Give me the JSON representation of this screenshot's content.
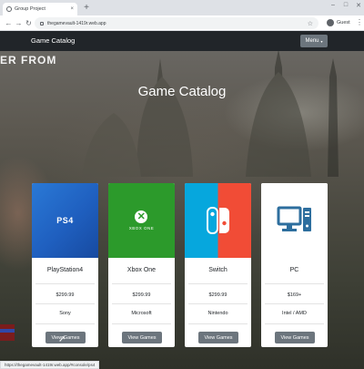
{
  "browser": {
    "tab_title": "Group Project",
    "tab_close": "×",
    "new_tab": "+",
    "url": "thegamevault-1419r.web.app",
    "profile_label": "Guest",
    "controls": {
      "minimize": "–",
      "maximize": "□",
      "close": "✕"
    },
    "nav": {
      "back": "←",
      "forward": "→",
      "reload": "↻",
      "star": "☆",
      "menu": "⋮"
    },
    "status_url": "https://thegamevault-1419r.web.app/#console/ps4"
  },
  "page": {
    "background_text": "ER FROM",
    "navbar": {
      "brand": "Game Catalog",
      "menu_label": "Menu",
      "menu_caret": "▾"
    },
    "hero_title": "Game Catalog",
    "cards": [
      {
        "name": "PlayStation4",
        "price": "$299.99",
        "maker": "Sony",
        "button": "View Games",
        "thumb_text": "PS4"
      },
      {
        "name": "Xbox One",
        "price": "$299.99",
        "maker": "Microsoft",
        "button": "View Games",
        "thumb_text": "XBOX ONE"
      },
      {
        "name": "Switch",
        "price": "$299.99",
        "maker": "Nintendo",
        "button": "View Games",
        "thumb_text": ""
      },
      {
        "name": "PC",
        "price": "$169+",
        "maker": "Intel / AMD",
        "button": "View Games",
        "thumb_text": ""
      }
    ]
  },
  "colors": {
    "navbar": "#212529",
    "button": "#6c757d",
    "ps4": "#2a79d6",
    "xbox": "#2c9a2b",
    "switch_left": "#06a7dd",
    "switch_right": "#f14c36",
    "pc_icon": "#2d6e9e"
  },
  "icons": {
    "ps4_thumb": "playstation-logo",
    "xbox_thumb": "xbox-logo",
    "switch_thumb": "nintendo-switch-logo",
    "pc_thumb": "desktop-computer-icon"
  }
}
